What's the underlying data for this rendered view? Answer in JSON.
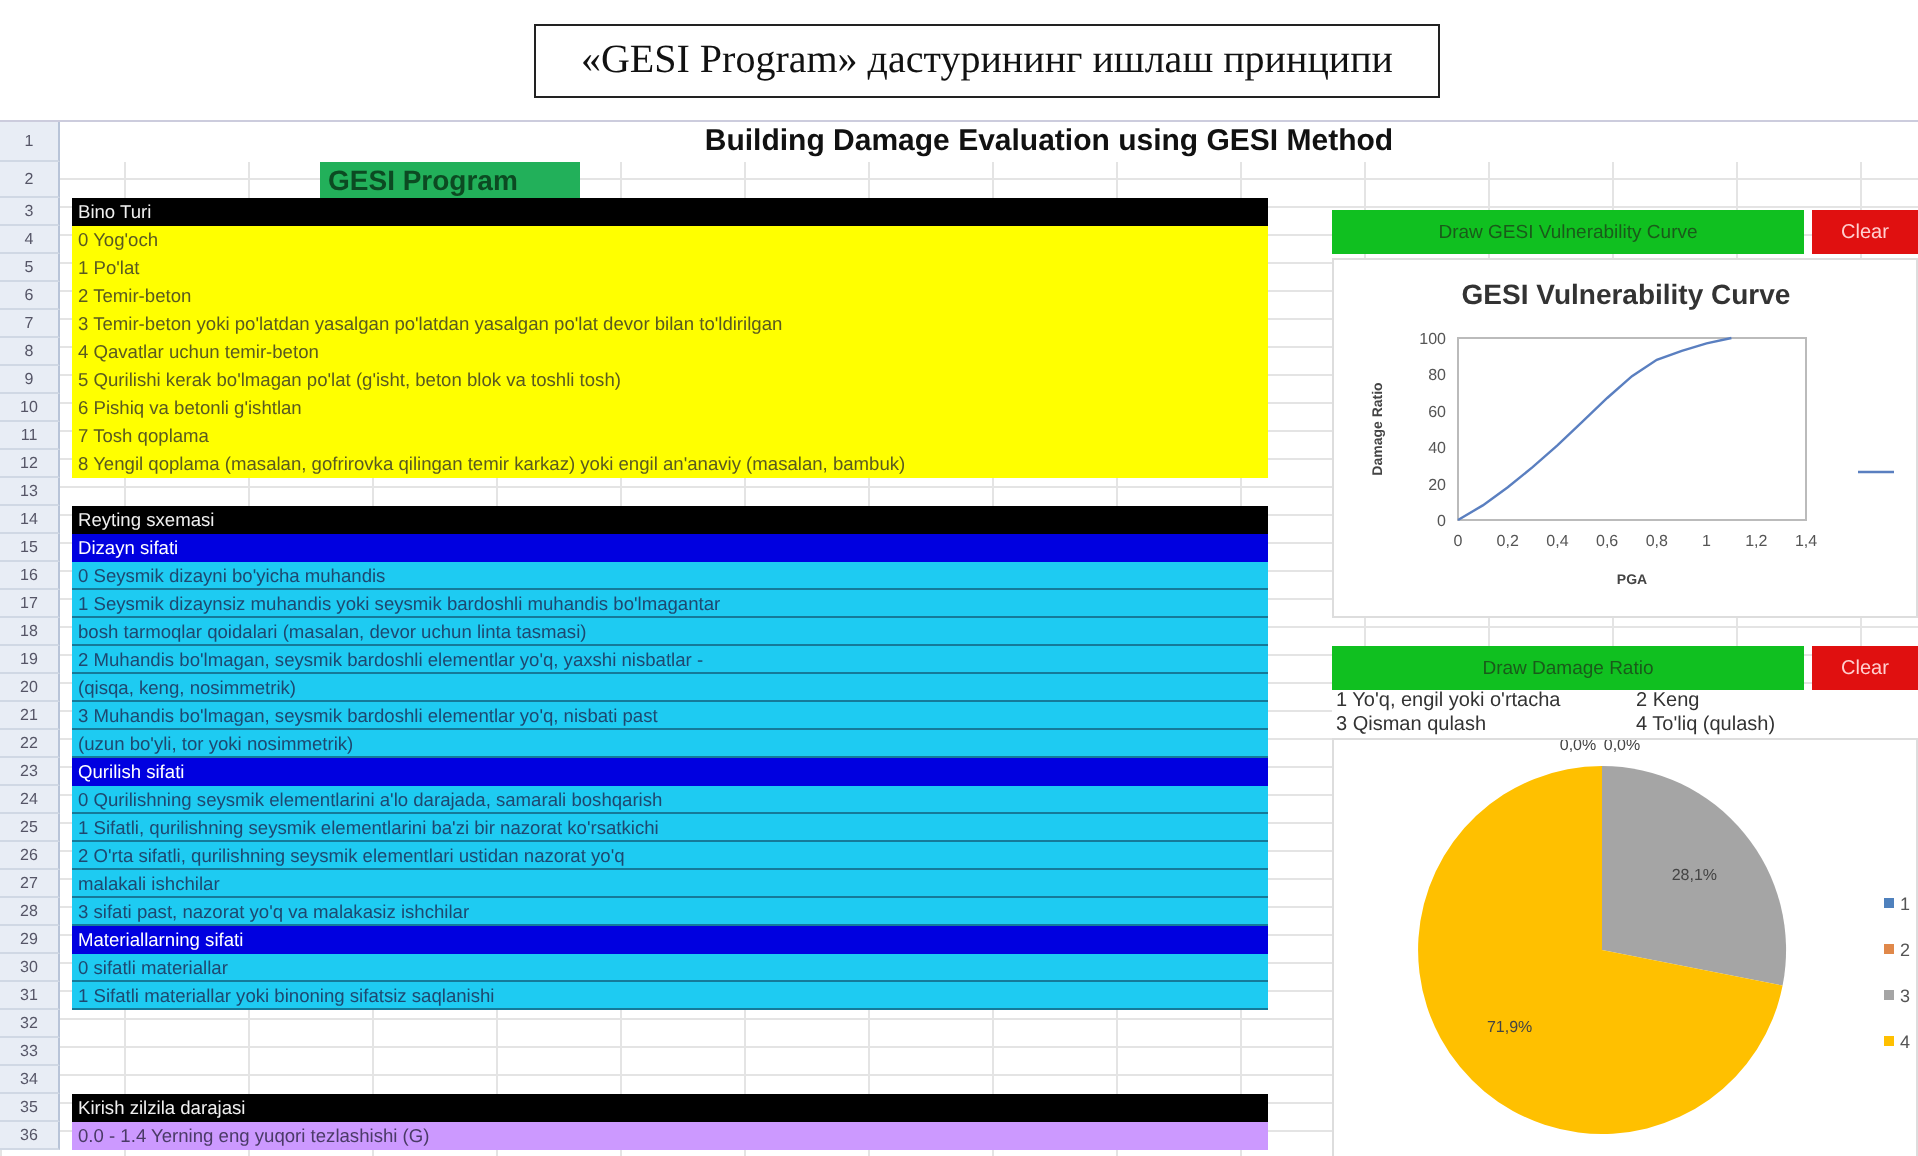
{
  "caption": "«GESI Program» дастурининг ишлаш принципи",
  "sheet": {
    "title_row": {
      "number": "1",
      "text": "Building Damage Evaluation using GESI Method"
    },
    "program_row": {
      "number": "2",
      "text": "GESI Program"
    },
    "rows": [
      {
        "number": "3",
        "kind": "header",
        "text": "Bino Turi"
      },
      {
        "number": "4",
        "kind": "yellow",
        "text": "0 Yog'och"
      },
      {
        "number": "5",
        "kind": "yellow",
        "text": "1 Po'lat"
      },
      {
        "number": "6",
        "kind": "yellow",
        "text": "2 Temir-beton"
      },
      {
        "number": "7",
        "kind": "yellow",
        "text": "3 Temir-beton yoki po'latdan yasalgan po'latdan yasalgan po'lat devor bilan to'ldirilgan"
      },
      {
        "number": "8",
        "kind": "yellow",
        "text": "4 Qavatlar uchun temir-beton"
      },
      {
        "number": "9",
        "kind": "yellow",
        "text": "5 Qurilishi kerak bo'lmagan po'lat (g'isht, beton blok va toshli tosh)"
      },
      {
        "number": "10",
        "kind": "yellow",
        "text": "6 Pishiq va betonli g'ishtlan"
      },
      {
        "number": "11",
        "kind": "yellow",
        "text": "7 Tosh qoplama"
      },
      {
        "number": "12",
        "kind": "yellow",
        "text": "8 Yengil qoplama (masalan, gofrirovka qilingan temir karkaz) yoki engil an'anaviy (masalan, bambuk)"
      },
      {
        "number": "13",
        "kind": "blank"
      },
      {
        "number": "14",
        "kind": "header",
        "text": "Reyting sxemasi"
      },
      {
        "number": "15",
        "kind": "section",
        "text": "Dizayn sifati"
      },
      {
        "number": "16",
        "kind": "cyan",
        "text": "0 Seysmik dizayni bo'yicha muhandis"
      },
      {
        "number": "17",
        "kind": "cyan",
        "text": "1 Seysmik dizaynsiz muhandis yoki seysmik bardoshli muhandis bo'lmagantar"
      },
      {
        "number": "18",
        "kind": "cyan",
        "text": "bosh tarmoqlar qoidalari (masalan, devor uchun linta tasmasi)"
      },
      {
        "number": "19",
        "kind": "cyan",
        "text": "2 Muhandis bo'lmagan, seysmik bardoshli elementlar yo'q, yaxshi nisbatlar -"
      },
      {
        "number": "20",
        "kind": "cyan",
        "text": "(qisqa, keng, nosimmetrik)"
      },
      {
        "number": "21",
        "kind": "cyan",
        "text": "3 Muhandis bo'lmagan, seysmik bardoshli elementlar yo'q, nisbati past"
      },
      {
        "number": "22",
        "kind": "cyan",
        "text": "(uzun bo'yli, tor yoki nosimmetrik)"
      },
      {
        "number": "23",
        "kind": "section",
        "text": "Qurilish sifati"
      },
      {
        "number": "24",
        "kind": "cyan",
        "text": "0 Qurilishning seysmik elementlarini a'lo darajada, samarali boshqarish"
      },
      {
        "number": "25",
        "kind": "cyan",
        "text": "1 Sifatli, qurilishning seysmik elementlarini ba'zi bir nazorat ko'rsatkichi"
      },
      {
        "number": "26",
        "kind": "cyan",
        "text": "2 O'rta sifatli, qurilishning seysmik elementlari ustidan nazorat yo'q"
      },
      {
        "number": "27",
        "kind": "cyan",
        "text": "malakali ishchilar"
      },
      {
        "number": "28",
        "kind": "cyan",
        "text": "3 sifati past, nazorat yo'q va malakasiz ishchilar"
      },
      {
        "number": "29",
        "kind": "section",
        "text": "Materiallarning sifati"
      },
      {
        "number": "30",
        "kind": "cyan",
        "text": "0 sifatli materiallar"
      },
      {
        "number": "31",
        "kind": "cyan",
        "text": "1 Sifatli materiallar yoki binoning sifatsiz saqlanishi"
      },
      {
        "number": "32",
        "kind": "blank"
      },
      {
        "number": "33",
        "kind": "blank"
      },
      {
        "number": "34",
        "kind": "blank"
      },
      {
        "number": "35",
        "kind": "header",
        "text": "Kirish zilzila darajasi"
      },
      {
        "number": "36",
        "kind": "purple",
        "text": "0.0 - 1.4 Yerning eng yuqori tezlashishi (G)"
      }
    ],
    "vulnerability_panel": {
      "draw_button": "Draw GESI Vulnerability Curve",
      "clear_button": "Clear",
      "chart_data": {
        "type": "line",
        "title": "GESI Vulnerability Curve",
        "xlabel": "PGA",
        "ylabel": "Damage Ratio",
        "x": [
          0,
          0.1,
          0.2,
          0.3,
          0.4,
          0.5,
          0.6,
          0.7,
          0.8,
          0.9,
          1.0,
          1.1
        ],
        "series": [
          {
            "color": "#5a7fc0",
            "values": [
              0,
              8,
              18,
              29,
              41,
              54,
              67,
              79,
              88,
              93,
              97,
              100
            ]
          }
        ],
        "xlim": [
          0,
          1.4
        ],
        "ylim": [
          0,
          100
        ],
        "xticks": [
          0,
          {
            "value": 0.2,
            "label": "0,2"
          },
          {
            "value": 0.4,
            "label": "0,4"
          },
          {
            "value": 0.6,
            "label": "0,6"
          },
          {
            "value": 0.8,
            "label": "0,8"
          },
          1,
          {
            "value": 1.2,
            "label": "1,2"
          },
          {
            "value": 1.4,
            "label": "1,4"
          }
        ],
        "yticks": [
          0,
          20,
          40,
          60,
          80,
          100
        ]
      }
    },
    "damage_panel": {
      "draw_button": "Draw Damage Ratio",
      "clear_button": "Clear",
      "legend": [
        "1  Yo'q, engil yoki o'rtacha",
        "2  Keng",
        "3  Qisman qulash",
        "4  To'liq (qulash)"
      ],
      "chart_data": {
        "type": "pie",
        "categories": [
          "1",
          "2",
          "3",
          "4"
        ],
        "series": [
          {
            "values": [
              0,
              0,
              28.1,
              71.9
            ]
          }
        ],
        "value_labels": [
          "0,0%",
          "0,0%",
          "28,1%",
          "71,9%"
        ],
        "legend": "right"
      }
    }
  }
}
